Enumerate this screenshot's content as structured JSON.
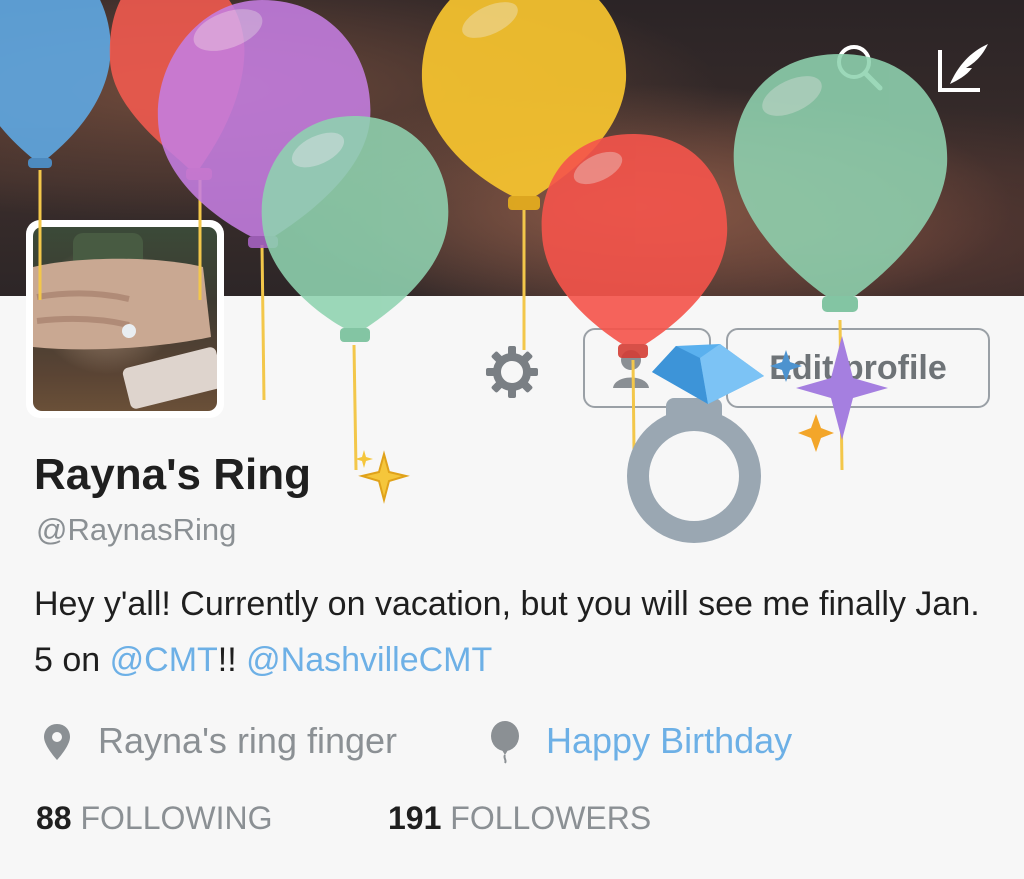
{
  "header": {
    "search_icon": "search-icon",
    "compose_icon": "compose-tweet-icon"
  },
  "profile": {
    "name": "Rayna's Ring",
    "name_emoji": "sparkles",
    "handle": "@RaynasRing",
    "bio_parts": {
      "text1": "Hey y'all! Currently on vacation, but you will see me finally Jan. 5 on ",
      "mention1": "@CMT",
      "text2": "!! ",
      "mention2": "@NashvilleCMT"
    },
    "location": "Rayna's ring finger",
    "birthday": "Happy Birthday"
  },
  "actions": {
    "settings_icon": "gear-icon",
    "follow_icon": "add-user-icon",
    "edit_profile_label": "Edit profile"
  },
  "stats": {
    "following_count": "88",
    "following_label": "FOLLOWING",
    "followers_count": "191",
    "followers_label": "FOLLOWERS"
  },
  "colors": {
    "link": "#6db0e6",
    "text": "#1f1f1f",
    "muted": "#8b9094"
  }
}
